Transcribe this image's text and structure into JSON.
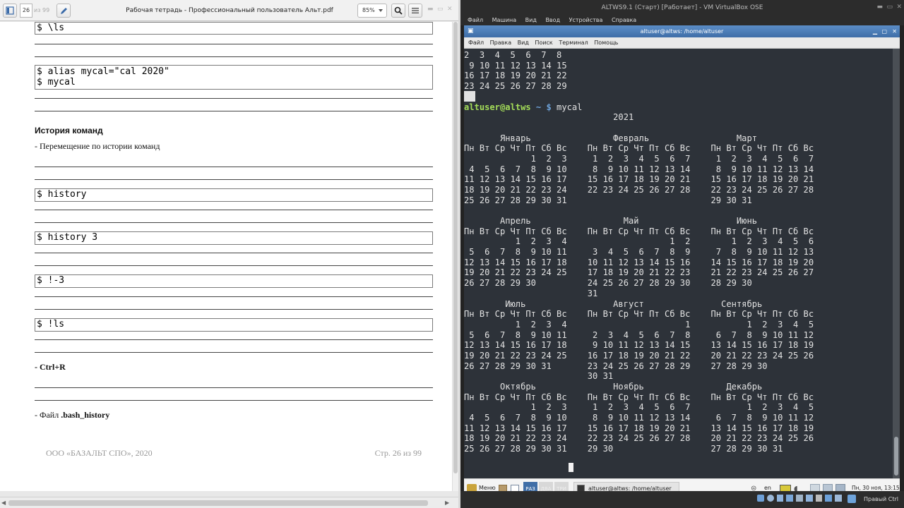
{
  "pdf_viewer": {
    "page_current": "26",
    "page_total": "из 99",
    "title": "Рабочая тетрадь - Профессиональный пользователь Альт.pdf",
    "zoom": "85%",
    "page": {
      "cmd_ls_escape": "$ \\ls",
      "cmd_alias_1": "$ alias mycal=\"cal 2020\"",
      "cmd_alias_2": "$ mycal",
      "heading_history": "История команд",
      "text_history_nav": "- Перемещение по истории команд",
      "cmd_history": "$ history",
      "cmd_history_3": "$ history 3",
      "cmd_bang_minus3": "$ !-3",
      "cmd_bang_ls": "$ !ls",
      "text_ctrl_r": "- Ctrl+R",
      "text_bash_history_prefix": "- Файл ",
      "text_bash_history_bold": ".bash_history",
      "footer_left": "ООО «БАЗАЛЬТ СПО», 2020",
      "footer_right": "Стр. 26 из 99"
    }
  },
  "virtualbox": {
    "window_title": "ALTWS9.1 (Старт) [Работает] - VM VirtualBox OSE",
    "menu": [
      "Файл",
      "Машина",
      "Вид",
      "Ввод",
      "Устройства",
      "Справка"
    ],
    "terminal": {
      "title": "altuser@altws: /home/altuser",
      "menu": [
        "Файл",
        "Правка",
        "Вид",
        "Поиск",
        "Терминал",
        "Помощь"
      ],
      "output": "2  3  4  5  6  7  8\n 9 10 11 12 13 14 15\n16 17 18 19 20 21 22\n23 24 25 26 27 28 29\n30\n\n                             2021\n\n       Январь                Февраль                 Март\nПн Вт Ср Чт Пт Сб Вс    Пн Вт Ср Чт Пт Сб Вс    Пн Вт Ср Чт Пт Сб Вс\n             1  2  3     1  2  3  4  5  6  7     1  2  3  4  5  6  7\n 4  5  6  7  8  9 10     8  9 10 11 12 13 14     8  9 10 11 12 13 14\n11 12 13 14 15 16 17    15 16 17 18 19 20 21    15 16 17 18 19 20 21\n18 19 20 21 22 23 24    22 23 24 25 26 27 28    22 23 24 25 26 27 28\n25 26 27 28 29 30 31                            29 30 31\n\n       Апрель                  Май                   Июнь\nПн Вт Ср Чт Пт Сб Вс    Пн Вт Ср Чт Пт Сб Вс    Пн Вт Ср Чт Пт Сб Вс\n          1  2  3  4                    1  2        1  2  3  4  5  6\n 5  6  7  8  9 10 11     3  4  5  6  7  8  9     7  8  9 10 11 12 13\n12 13 14 15 16 17 18    10 11 12 13 14 15 16    14 15 16 17 18 19 20\n19 20 21 22 23 24 25    17 18 19 20 21 22 23    21 22 23 24 25 26 27\n26 27 28 29 30          24 25 26 27 28 29 30    28 29 30\n                        31\n        Июль                 Август               Сентябрь\nПн Вт Ср Чт Пт Сб Вс    Пн Вт Ср Чт Пт Сб Вс    Пн Вт Ср Чт Пт Сб Вс\n          1  2  3  4                       1           1  2  3  4  5\n 5  6  7  8  9 10 11     2  3  4  5  6  7  8     6  7  8  9 10 11 12\n12 13 14 15 16 17 18     9 10 11 12 13 14 15    13 14 15 16 17 18 19\n19 20 21 22 23 24 25    16 17 18 19 20 21 22    20 21 22 23 24 25 26\n26 27 28 29 30 31       23 24 25 26 27 28 29    27 28 29 30\n                        30 31\n       Октябрь               Ноябрь                Декабрь\nПн Вт Ср Чт Пт Сб Вс    Пн Вт Ср Чт Пт Сб Вс    Пн Вт Ср Чт Пт Сб Вс\n             1  2  3     1  2  3  4  5  6  7           1  2  3  4  5\n 4  5  6  7  8  9 10     8  9 10 11 12 13 14     6  7  8  9 10 11 12\n11 12 13 14 15 16 17    15 16 17 18 19 20 21    13 14 15 16 17 18 19\n18 19 20 21 22 23 24    22 23 24 25 26 27 28    20 21 22 23 24 25 26\n25 26 27 28 29 30 31    29 30                   27 28 29 30 31",
      "prompt_user": "altuser@altws",
      "prompt_path": " ~ $",
      "prompt_cmd_1": " mycal",
      "prompt_cmd_2": " "
    },
    "taskbar": {
      "menu_label": "Меню",
      "workspace_1": "РАЗ",
      "workspace_2": "ДВА",
      "workspace_3": "ТРИ",
      "task_terminal": "altuser@altws: /home/altuser",
      "keyboard_layout": "en",
      "clock": "Пн, 30 ноя, 13:15"
    },
    "host_key": "Правый Ctrl"
  },
  "colors": {
    "terminal_bg": "#2d3239",
    "prompt_user": "#a4dd58",
    "prompt_path": "#6ea3da",
    "terminal_titlebar": "#4a7bb6"
  }
}
